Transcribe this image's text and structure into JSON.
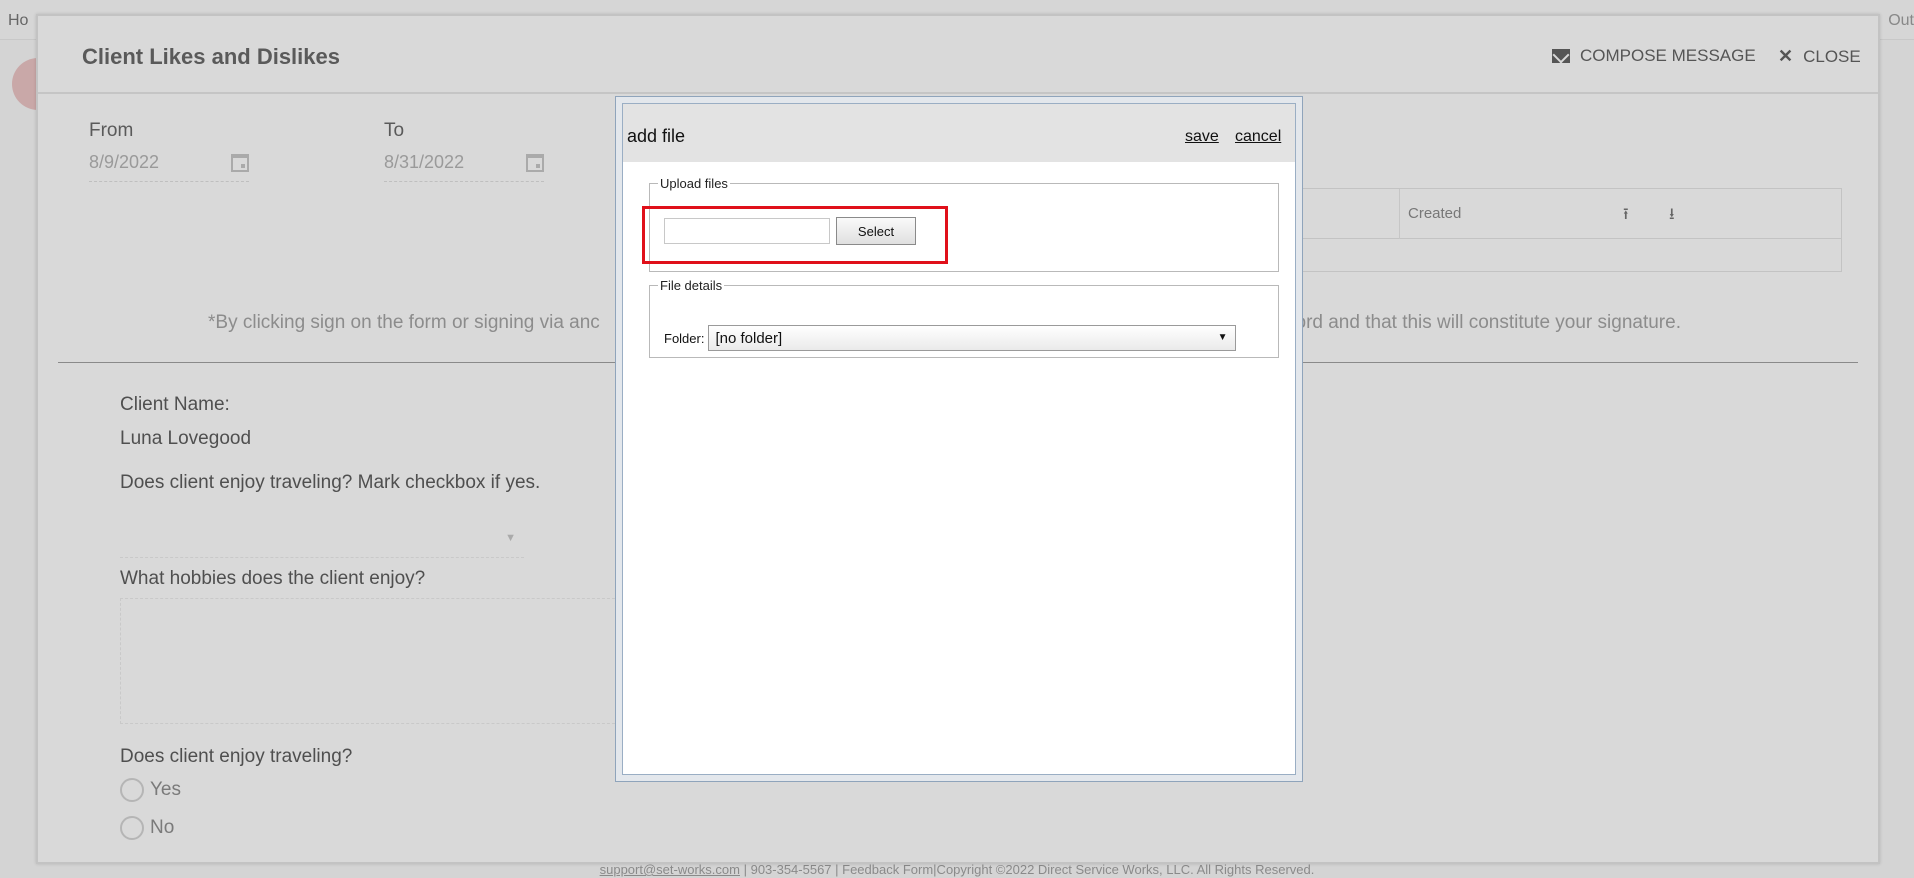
{
  "background": {
    "home_fragment": "Ho",
    "logout_fragment": "Out",
    "footer_email": "support@set-works.com",
    "footer_rest": "| 903-354-5567 | Feedback Form|Copyright ©2022 Direct Service Works, LLC. All Rights Reserved."
  },
  "outer_modal": {
    "title": "Client Likes and Dislikes",
    "compose_label": "COMPOSE MESSAGE",
    "close_label": "CLOSE",
    "from_label": "From",
    "from_value": "8/9/2022",
    "to_label": "To",
    "to_value": "8/31/2022",
    "files_table": {
      "created_header": "Created"
    },
    "disclaimer_left": "*By clicking sign on the form or signing via anc",
    "disclaimer_right": "cord and that this will constitute your signature.",
    "form": {
      "client_name_label": "Client Name:",
      "client_name_value": "Luna Lovegood",
      "q1": "Does client enjoy traveling? Mark checkbox if yes.",
      "q2": "What hobbies does the client enjoy?",
      "q3": "Does client enjoy traveling?",
      "opt_yes": "Yes",
      "opt_no": "No"
    }
  },
  "dialog": {
    "title": "add file",
    "save_label": "save",
    "cancel_label": "cancel",
    "upload_legend": "Upload files",
    "file_input_value": "",
    "select_label": "Select",
    "details_legend": "File details",
    "folder_label": "Folder:",
    "folder_value": "[no folder]"
  },
  "colors": {
    "highlight": "#e0101a"
  }
}
